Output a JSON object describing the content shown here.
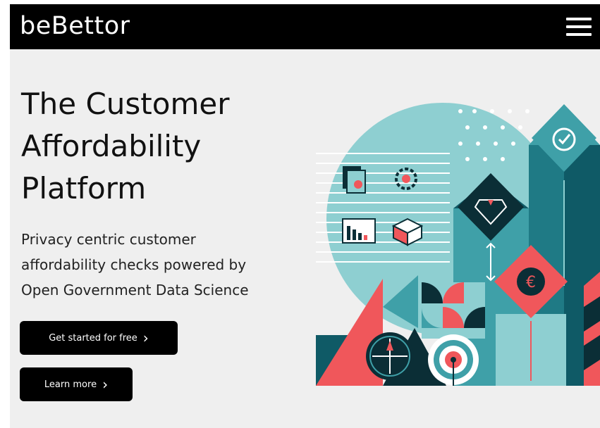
{
  "header": {
    "logo": "beBettor",
    "menu_icon": "hamburger-menu-icon"
  },
  "hero": {
    "title_lines": [
      "The Customer",
      "Affordability",
      "Platform"
    ],
    "subtitle_lines": [
      "Privacy centric customer",
      "affordability checks powered by",
      "Open Government Data Science"
    ]
  },
  "buttons": {
    "primary_label": "Get started for free",
    "secondary_label": "Learn more",
    "chevron": "›"
  },
  "illustration": {
    "currency_symbol": "€",
    "colors": {
      "teal_light": "#8ecfd1",
      "teal_mid": "#3fa0a8",
      "teal_dark": "#0f5a66",
      "navy": "#0b2e36",
      "coral": "#f0575b",
      "white": "#ffffff"
    }
  }
}
